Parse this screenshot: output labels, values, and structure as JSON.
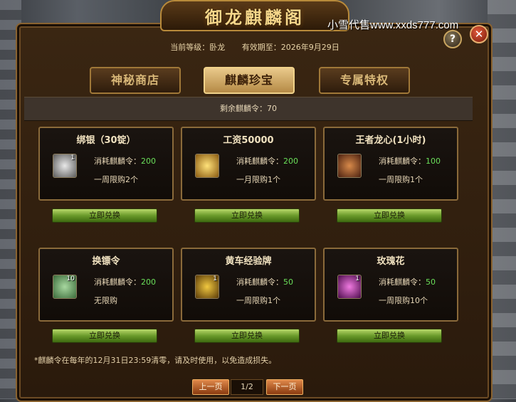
{
  "window": {
    "title": "御龙麒麟阁",
    "watermark": "小雪代售www.xxds777.com",
    "help_label": "?",
    "close_label": "✕"
  },
  "status": {
    "level": "当前等级：卧龙",
    "expiry": "有效期至：2026年9月29日"
  },
  "tabs": [
    {
      "label": "神秘商店",
      "active": false
    },
    {
      "label": "麒麟珍宝",
      "active": true
    },
    {
      "label": "专属特权",
      "active": false
    }
  ],
  "remaining": "剩余麒麟令：70",
  "items": [
    {
      "title": "绑银（30锭）",
      "icon": "silver-ingot-icon",
      "count": "1",
      "cost_label": "消耗麒麟令：",
      "cost": "200",
      "limit": "一周限购2个",
      "button": "立即兑换",
      "color": "#cfcfcf"
    },
    {
      "title": "工资50000",
      "icon": "gold-coins-icon",
      "count": "",
      "cost_label": "消耗麒麟令：",
      "cost": "200",
      "limit": "一月限购1个",
      "button": "立即兑换",
      "color": "#e0b040"
    },
    {
      "title": "王者龙心(1小时)",
      "icon": "dragon-heart-icon",
      "count": "",
      "cost_label": "消耗麒麟令：",
      "cost": "100",
      "limit": "一周限购1个",
      "button": "立即兑换",
      "color": "#b86a3a"
    },
    {
      "title": "换镖令",
      "icon": "escort-token-icon",
      "count": "10",
      "cost_label": "消耗麒麟令：",
      "cost": "200",
      "limit": "无限购",
      "button": "立即兑换",
      "color": "#7aa86a"
    },
    {
      "title": "黄车经验牌",
      "icon": "yellow-cart-icon",
      "count": "1",
      "cost_label": "消耗麒麟令：",
      "cost": "50",
      "limit": "一周限购1个",
      "button": "立即兑换",
      "color": "#d8a830"
    },
    {
      "title": "玫瑰花",
      "icon": "rose-icon",
      "count": "1",
      "cost_label": "消耗麒麟令：",
      "cost": "50",
      "limit": "一周限购10个",
      "button": "立即兑换",
      "color": "#c23ab8"
    }
  ],
  "note": "*麒麟令在每年的12月31日23:59清零，请及时使用，以免造成损失。",
  "pager": {
    "prev": "上一页",
    "page": "1/2",
    "next": "下一页"
  }
}
